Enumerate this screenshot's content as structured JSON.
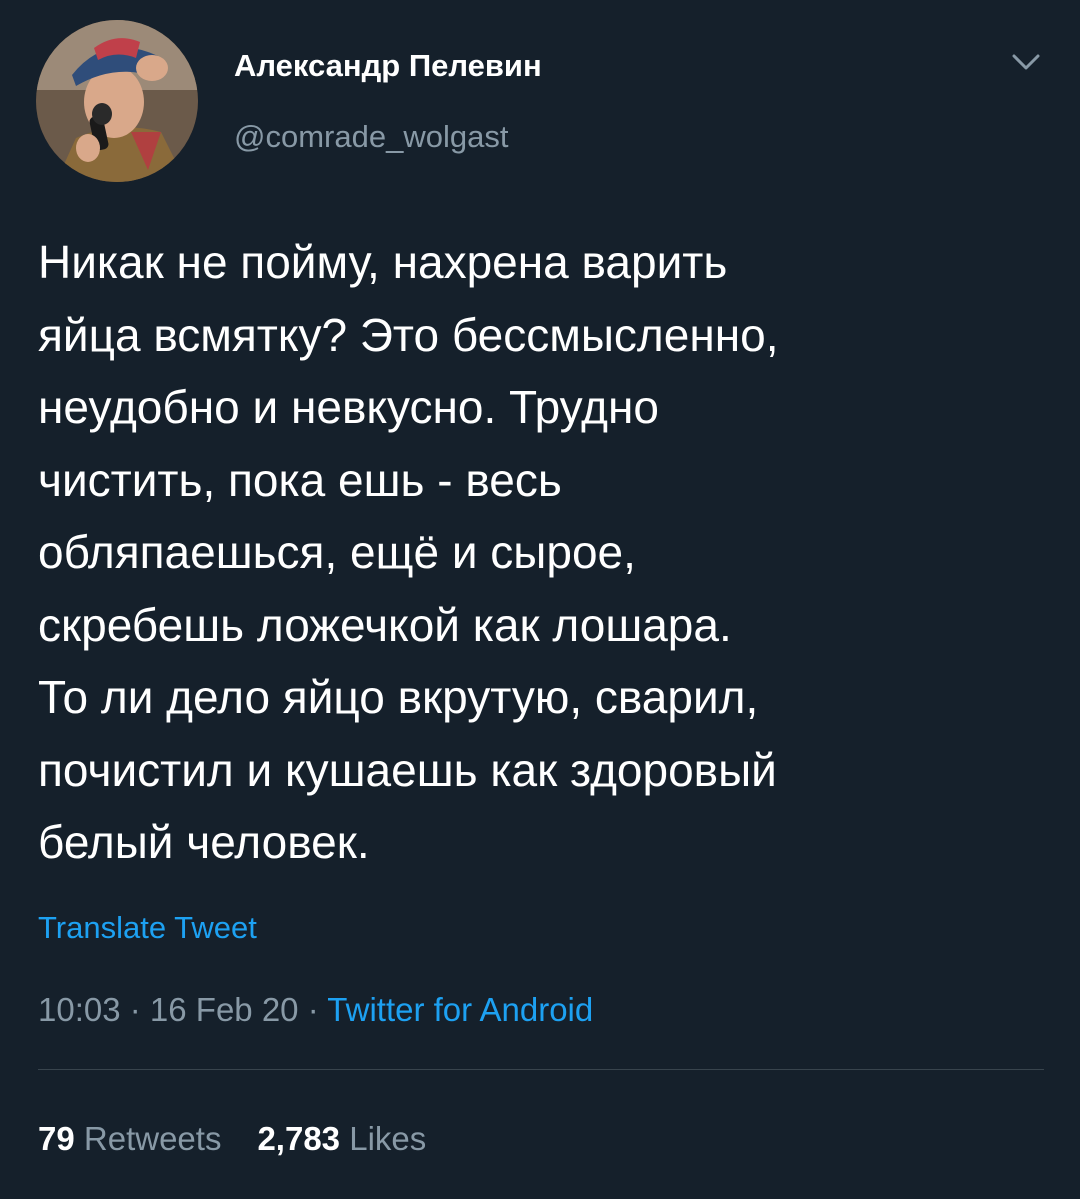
{
  "tweet": {
    "author": {
      "display_name": "Александр Пелевин",
      "handle": "@comrade_wolgast"
    },
    "text": "Никак не пойму, нахрена варить\nяйца всмятку? Это бессмысленно,\nнеудобно и невкусно. Трудно\nчистить, пока ешь - весь\nобляпаешься, ещё и сырое,\nскребешь ложечкой как лошара.\nТо ли дело яйцо вкрутую, сварил,\nпочистил и кушаешь как здоровый\nбелый человек.",
    "translate_label": "Translate Tweet",
    "meta": {
      "time": "10:03",
      "separator": " · ",
      "date": "16 Feb 20",
      "source": "Twitter for Android"
    },
    "stats": {
      "retweets_count": "79",
      "retweets_label": "Retweets",
      "likes_count": "2,783",
      "likes_label": "Likes"
    }
  },
  "icons": {
    "menu": "chevron-down-icon",
    "avatar": "avatar"
  },
  "colors": {
    "background": "#15202b",
    "primary_text": "#ffffff",
    "secondary_text": "#8899a6",
    "accent": "#1da1f2",
    "divider": "#38444d"
  }
}
